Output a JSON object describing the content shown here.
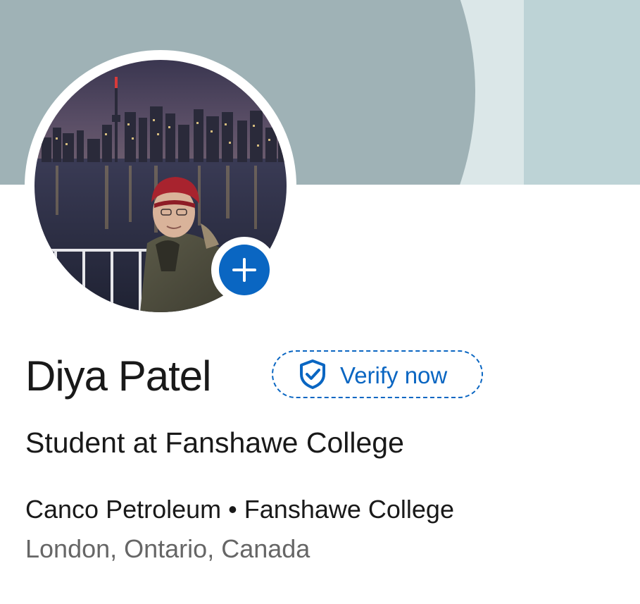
{
  "profile": {
    "name": "Diya Patel",
    "verify_label": "Verify now",
    "headline": "Student at Fanshawe College",
    "experience": {
      "company": "Canco Petroleum",
      "separator": "•",
      "school": "Fanshawe College"
    },
    "location": "London, Ontario, Canada"
  },
  "colors": {
    "accent": "#0a66c2",
    "banner_dark": "#9fb2b6",
    "banner_light": "#dbe7e8",
    "text_primary": "#191919",
    "text_secondary": "#666666"
  },
  "icons": {
    "add_photo": "plus-icon",
    "verify": "shield-check-icon"
  }
}
